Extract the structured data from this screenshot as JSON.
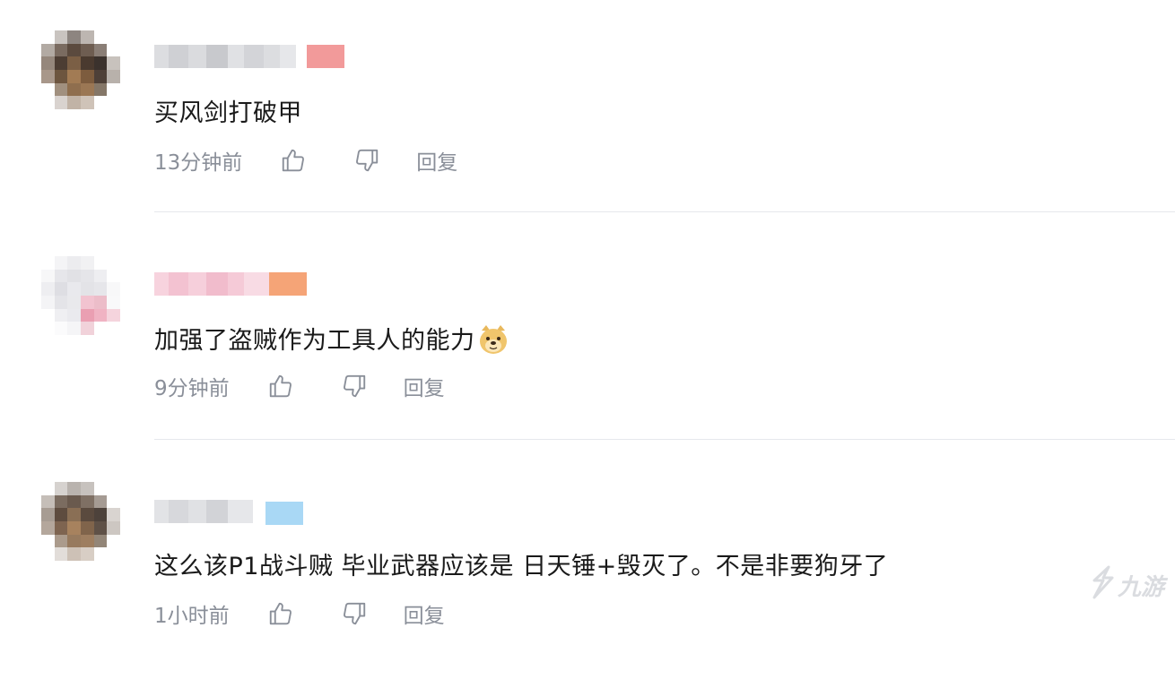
{
  "comments": [
    {
      "text": "买风剑打破甲",
      "time": "13分钟前",
      "reply": "回复"
    },
    {
      "text": "加强了盗贼作为工具人的能力",
      "emoji": "doge-emoji",
      "time": "9分钟前",
      "reply": "回复"
    },
    {
      "text": "这么该P1战斗贼 毕业武器应该是 日天锤+毁灭了。不是非要狗牙了",
      "time": "1小时前",
      "reply": "回复"
    }
  ],
  "icons": {
    "like": "thumbs-up-icon",
    "dislike": "thumbs-down-icon"
  },
  "watermark": {
    "text": "九游",
    "logo": "jiuyou-logo"
  },
  "colors": {
    "text": "#1a1a1a",
    "meta": "#8a8f99",
    "divider": "#e6e8ec",
    "badge_1": "#f29a9a",
    "badge_2": "#f5a477",
    "badge_3": "#a9d8f5"
  }
}
